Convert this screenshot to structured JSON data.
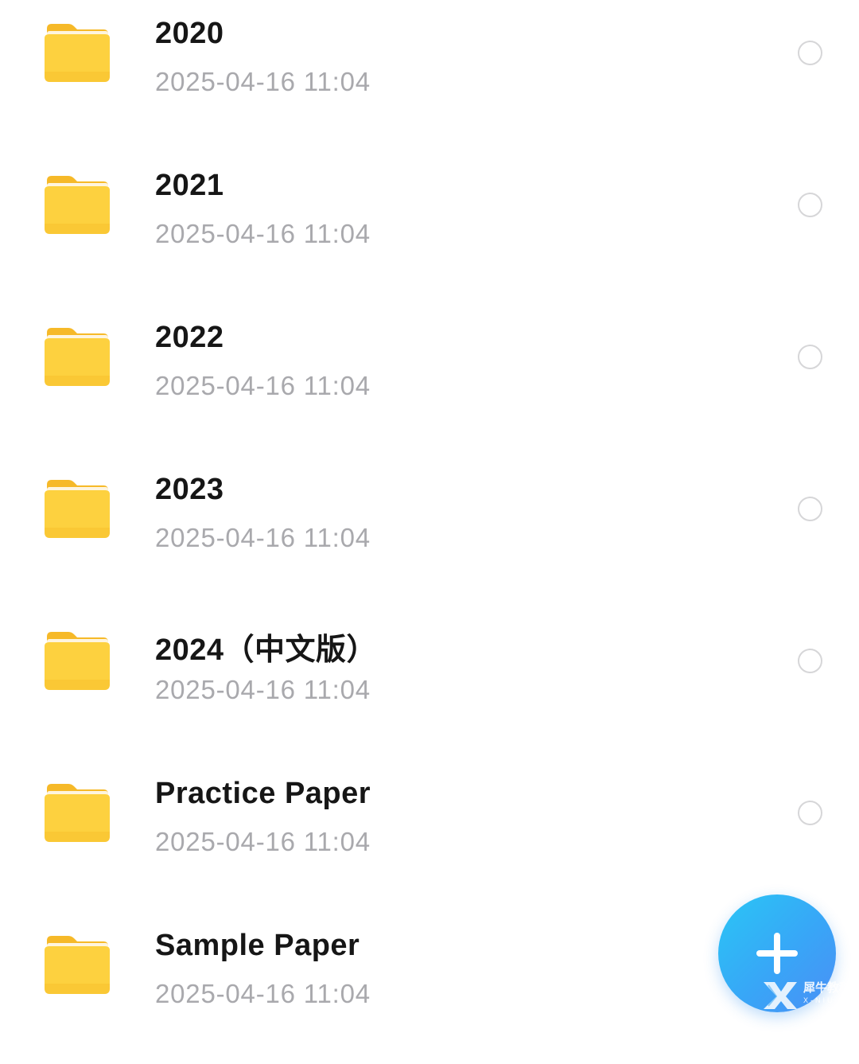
{
  "files": [
    {
      "name": "2020",
      "date": "2025-04-16 11:04",
      "icon": "folder-icon",
      "type": "folder",
      "selected": false
    },
    {
      "name": "2021",
      "date": "2025-04-16 11:04",
      "icon": "folder-icon",
      "type": "folder",
      "selected": false
    },
    {
      "name": "2022",
      "date": "2025-04-16 11:04",
      "icon": "folder-icon",
      "type": "folder",
      "selected": false
    },
    {
      "name": "2023",
      "date": "2025-04-16 11:04",
      "icon": "folder-icon",
      "type": "folder",
      "selected": false
    },
    {
      "name": "2024（中文版）",
      "date": "2025-04-16 11:04",
      "icon": "folder-icon",
      "type": "folder",
      "selected": false
    },
    {
      "name": "Practice Paper",
      "date": "2025-04-16 11:04",
      "icon": "folder-icon",
      "type": "folder",
      "selected": false
    },
    {
      "name": "Sample Paper",
      "date": "2025-04-16 11:04",
      "icon": "folder-icon",
      "type": "folder",
      "selected": false
    }
  ],
  "fab": {
    "icon": "plus-icon"
  },
  "watermark": {
    "text": "犀牛教程",
    "subtext": "X-NIU"
  },
  "colors": {
    "folder": "#fccf3a",
    "folder_tab": "#f9c02a",
    "name_text": "#161616",
    "date_text": "#a9a9ad",
    "radio_border": "#d6d6d8",
    "fab_accent": "#38a6f7"
  }
}
